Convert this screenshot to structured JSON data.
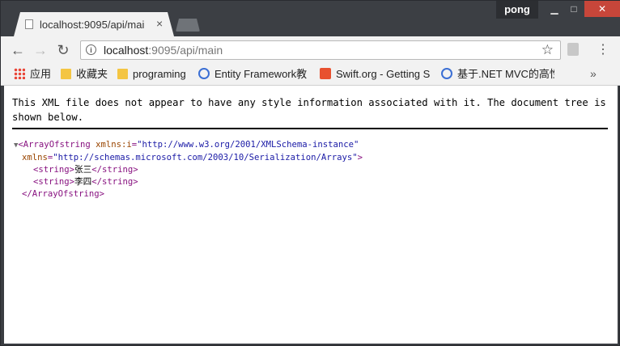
{
  "window": {
    "user_name": "pong",
    "minimize_glyph": "▁",
    "maximize_glyph": "□",
    "close_glyph": "✕"
  },
  "tab": {
    "title": "localhost:9095/api/mai",
    "close_glyph": "×"
  },
  "toolbar": {
    "back_glyph": "←",
    "forward_glyph": "→",
    "reload_glyph": "↻",
    "url_host": "localhost",
    "url_rest": ":9095/api/main",
    "info_glyph": "i",
    "star_glyph": "☆",
    "menu_glyph": "⋮"
  },
  "bookmarks": {
    "items": [
      {
        "label": "应用",
        "icon": "apps-icon"
      },
      {
        "label": "收藏夹",
        "icon": "folder-icon"
      },
      {
        "label": "programing",
        "icon": "folder-icon"
      },
      {
        "label": "Entity Framework教",
        "icon": "circle-icon"
      },
      {
        "label": "Swift.org - Getting S",
        "icon": "swift-icon"
      },
      {
        "label": "基于.NET MVC的高性",
        "icon": "circle-icon"
      }
    ],
    "more_glyph": "»"
  },
  "page": {
    "notice": "This XML file does not appear to have any style information associated with it. The document tree is shown below.",
    "xml": {
      "collapse_glyph": "▼",
      "root_open": "<ArrayOfstring",
      "attr1_name": "xmlns:i",
      "attr1_value": "\"http://www.w3.org/2001/XMLSchema-instance\"",
      "attr2_name": "xmlns",
      "attr2_value": "\"http://schemas.microsoft.com/2003/10/Serialization/Arrays\"",
      "root_close_bracket": ">",
      "items": [
        "张三",
        "李四"
      ],
      "item_open": "<string>",
      "item_close": "</string>",
      "root_close": "</ArrayOfstring>"
    }
  }
}
